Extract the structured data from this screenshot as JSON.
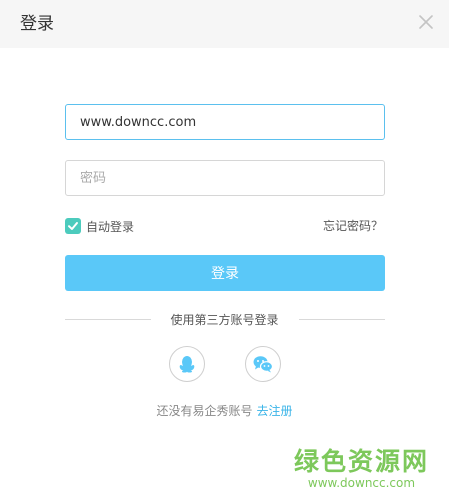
{
  "header": {
    "title": "登录",
    "close_icon": "close-icon"
  },
  "form": {
    "username": {
      "value": "www.downcc.com",
      "placeholder": ""
    },
    "password": {
      "value": "",
      "placeholder": "密码"
    },
    "remember_label": "自动登录",
    "remember_checked": true,
    "forgot_label": "忘记密码？",
    "submit_label": "登录"
  },
  "third_party": {
    "label": "使用第三方账号登录",
    "providers": [
      {
        "name": "QQ",
        "icon": "qq-icon"
      },
      {
        "name": "WeChat",
        "icon": "wechat-icon"
      }
    ]
  },
  "register": {
    "prompt": "还没有易企秀账号",
    "link": "去注册"
  },
  "watermark": {
    "title": "绿色资源网",
    "url": "www.downcc.com"
  },
  "colors": {
    "accent": "#5ac8f8",
    "checkbox": "#4ccbbd",
    "link": "#3ab4e8",
    "watermark": "#7dc85b",
    "header_bg": "#f6f6f6"
  }
}
